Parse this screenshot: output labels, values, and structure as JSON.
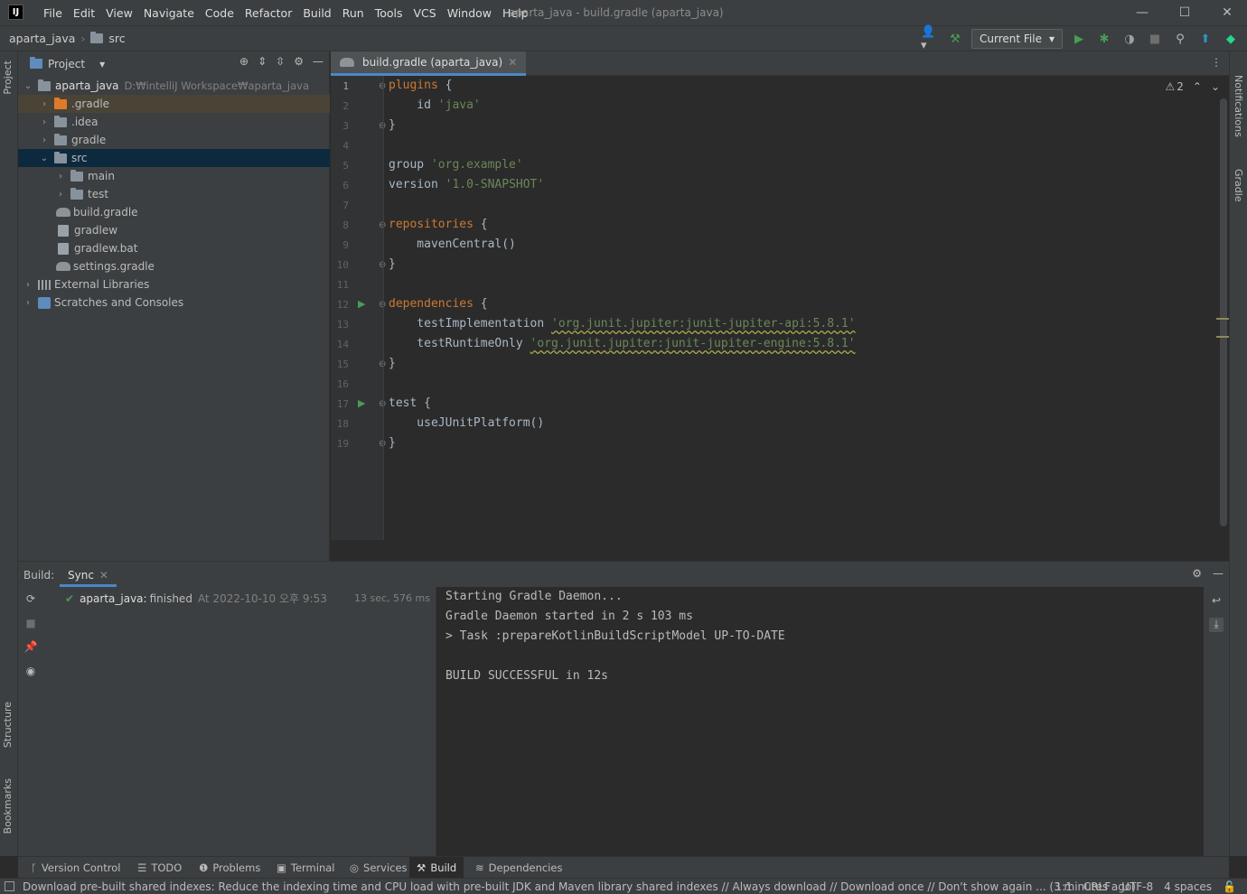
{
  "window": {
    "logo": "IJ",
    "title": "aparta_java - build.gradle (aparta_java)",
    "menu": [
      "File",
      "Edit",
      "View",
      "Navigate",
      "Code",
      "Refactor",
      "Build",
      "Run",
      "Tools",
      "VCS",
      "Window",
      "Help"
    ]
  },
  "navbar": {
    "project": "aparta_java",
    "folder": "src",
    "run_config": "Current File"
  },
  "left_stripe": {
    "project_tab": "Project",
    "structure_tab": "Structure",
    "bookmarks_tab": "Bookmarks"
  },
  "right_stripe": {
    "notifications_tab": "Notifications",
    "gradle_tab": "Gradle"
  },
  "project_panel": {
    "title": "Project",
    "root_name": "aparta_java",
    "root_path": "D:₩intelliJ Workspace₩aparta_java",
    "items": [
      {
        "label": ".gradle"
      },
      {
        "label": ".idea"
      },
      {
        "label": "gradle"
      },
      {
        "label": "src"
      },
      {
        "label": "main"
      },
      {
        "label": "test"
      },
      {
        "label": "build.gradle"
      },
      {
        "label": "gradlew"
      },
      {
        "label": "gradlew.bat"
      },
      {
        "label": "settings.gradle"
      },
      {
        "label": "External Libraries"
      },
      {
        "label": "Scratches and Consoles"
      }
    ]
  },
  "editor": {
    "tab_label": "build.gradle (aparta_java)",
    "warning_count": "2",
    "line_numbers": [
      "1",
      "2",
      "3",
      "4",
      "5",
      "6",
      "7",
      "8",
      "9",
      "10",
      "11",
      "12",
      "13",
      "14",
      "15",
      "16",
      "17",
      "18",
      "19"
    ],
    "code": {
      "l1_kw": "plugins",
      "l1_rest": " {",
      "l2_a": "    id ",
      "l2_str": "'java'",
      "l3": "}",
      "l5_a": "group ",
      "l5_str": "'org.example'",
      "l6_a": "version ",
      "l6_str": "'1.0-SNAPSHOT'",
      "l8_kw": "repositories",
      "l8_rest": " {",
      "l9": "    mavenCentral()",
      "l10": "}",
      "l12_kw": "dependencies",
      "l12_rest": " {",
      "l13_a": "    testImplementation ",
      "l13_str": "'org.junit.jupiter:junit-jupiter-api:5.8.1'",
      "l14_a": "    testRuntimeOnly ",
      "l14_str": "'org.junit.jupiter:junit-jupiter-engine:5.8.1'",
      "l15": "}",
      "l17": "test {",
      "l18": "    useJUnitPlatform()",
      "l19": "}"
    }
  },
  "build_panel": {
    "label": "Build:",
    "tab": "Sync",
    "sync_project": "aparta_java:",
    "sync_status": "finished",
    "sync_time": "At 2022-10-10 오후 9:53",
    "duration": "13 sec, 576 ms",
    "console": [
      "Starting Gradle Daemon...",
      "Gradle Daemon started in 2 s 103 ms",
      "> Task :prepareKotlinBuildScriptModel UP-TO-DATE",
      "",
      "BUILD SUCCESSFUL in 12s"
    ]
  },
  "tool_windows": [
    "Version Control",
    "TODO",
    "Problems",
    "Terminal",
    "Services",
    "Build",
    "Dependencies"
  ],
  "status_bar": {
    "message": "Download pre-built shared indexes: Reduce the indexing time and CPU load with pre-built JDK and Maven library shared indexes // Always download // Download once // Don't show again ... (3 minutes ago)",
    "position": "1:1",
    "line_sep": "CRLF",
    "encoding": "UTF-8",
    "indent": "4 spaces"
  },
  "colors": {
    "background": "#2b2b2b",
    "panel": "#3c3f41",
    "keyword": "#cc7832",
    "string": "#6a8759",
    "accent": "#4a88c7",
    "success": "#499c54"
  }
}
